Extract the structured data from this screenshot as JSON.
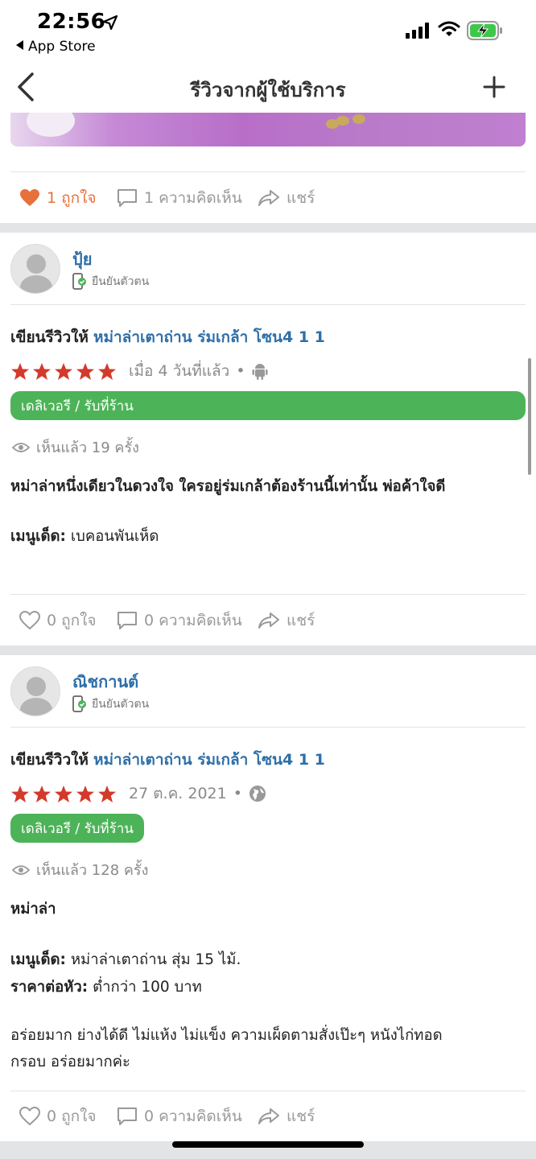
{
  "status_bar": {
    "time": "22:56",
    "back_app_label": "App Store"
  },
  "navbar": {
    "title": "รีวิวจากผู้ใช้บริการ"
  },
  "colors": {
    "link_blue": "#2e6fa8",
    "liked_orange": "#e8703a",
    "tag_green": "#4db358",
    "star_red": "#d33a2c"
  },
  "top_actions": {
    "like": "1 ถูกใจ",
    "comment": "1 ความคิดเห็น",
    "share": "แชร์"
  },
  "reviews": [
    {
      "username": "ปุ้ย",
      "verified_label": "ยืนยันตัวตน",
      "review_for_label": "เขียนรีวิวให้",
      "place": "หม่าล่าเตาถ่าน ร่มเกล้า โซน4 1 1",
      "rating": 5,
      "when": "เมื่อ 4 วันที่แล้ว",
      "platform_icon": "android-icon",
      "tag": "เดลิเวอรี / รับที่ร้าน",
      "views": "เห็นแล้ว 19 ครั้ง",
      "headline": "หม่าล่าหนึ่งเดียวในดวงใจ ใครอยู่ร่มเกล้าต้องร้านนี้เท่านั้น พ่อค้าใจดี",
      "menu_label": "เมนูเด็ด:",
      "menu_value": "เบคอนพันเห็ด",
      "actions": {
        "like": "0 ถูกใจ",
        "comment": "0 ความคิดเห็น",
        "share": "แชร์"
      }
    },
    {
      "username": "ณิชกานต์",
      "verified_label": "ยืนยันตัวตน",
      "review_for_label": "เขียนรีวิวให้",
      "place": "หม่าล่าเตาถ่าน ร่มเกล้า โซน4 1 1",
      "rating": 5,
      "when": "27 ต.ค. 2021",
      "platform_icon": "globe-icon",
      "tag": "เดลิเวอรี / รับที่ร้าน",
      "views": "เห็นแล้ว 128 ครั้ง",
      "headline": "หม่าล่า",
      "menu_label": "เมนูเด็ด:",
      "menu_value": "หม่าล่าเตาถ่าน สุ่ม 15 ไม้.",
      "price_label": "ราคาต่อหัว:",
      "price_value": "ต่ำกว่า 100 บาท",
      "comment_line1": "อร่อยมาก ย่างได้ดี ไม่แห้ง ไม่แข็ง ความเผ็ดตามสั่งเป๊ะๆ หนังไก่ทอด",
      "comment_line2": "กรอบ อร่อยมากค่ะ",
      "actions": {
        "like": "0 ถูกใจ",
        "comment": "0 ความคิดเห็น",
        "share": "แชร์"
      }
    }
  ]
}
